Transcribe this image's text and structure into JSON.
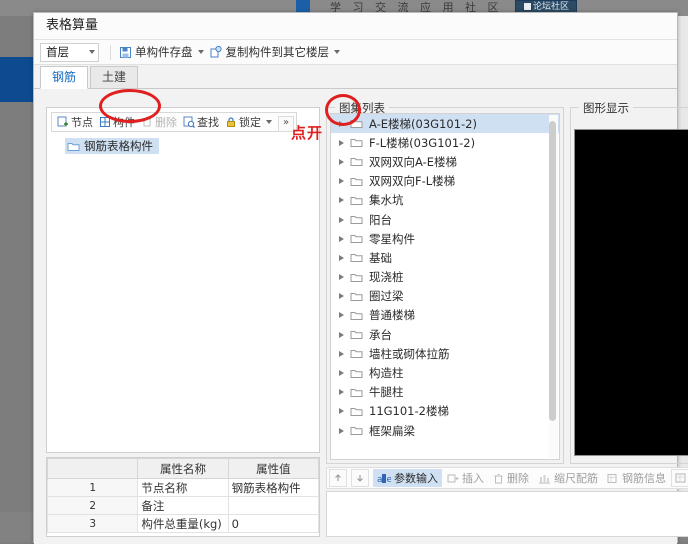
{
  "background": {
    "banner_text": "学 习 交 流 应 用 社 区",
    "logo_text": "论坛社区"
  },
  "window": {
    "title": "表格算量"
  },
  "command_bar": {
    "floor_select": {
      "value": "首层"
    },
    "buttons": [
      {
        "label": "单构件存盘",
        "icon": "save-component-icon",
        "has_caret": true
      },
      {
        "label": "复制构件到其它楼层",
        "icon": "copy-component-icon",
        "has_caret": true
      }
    ]
  },
  "tabs": [
    {
      "label": "钢筋",
      "active": true
    },
    {
      "label": "土建",
      "active": false
    }
  ],
  "left_panel": {
    "toolbar": [
      {
        "label": "节点",
        "icon": "add-node-icon",
        "disabled": false
      },
      {
        "label": "构件",
        "icon": "component-icon",
        "disabled": false
      },
      {
        "label": "删除",
        "icon": "trash-icon",
        "disabled": true
      },
      {
        "label": "查找",
        "icon": "find-icon",
        "disabled": false
      },
      {
        "label": "锁定",
        "icon": "lock-icon",
        "disabled": false,
        "has_caret": true
      }
    ],
    "overflow_label": "»",
    "tree_node": {
      "label": "钢筋表格构件",
      "icon": "folder-icon",
      "selected": true
    },
    "properties": {
      "headers": [
        "属性名称",
        "属性值"
      ],
      "rows": [
        {
          "num": "1",
          "name": "节点名称",
          "value": "钢筋表格构件"
        },
        {
          "num": "2",
          "name": "备注",
          "value": ""
        },
        {
          "num": "3",
          "name": "构件总重量(kg)",
          "value": "0"
        }
      ]
    }
  },
  "middle_panel": {
    "group_label": "图集列表",
    "items": [
      {
        "label": "A-E楼梯(03G101-2)",
        "selected": true
      },
      {
        "label": "F-L楼梯(03G101-2)",
        "selected": false
      },
      {
        "label": "双网双向A-E楼梯",
        "selected": false
      },
      {
        "label": "双网双向F-L楼梯",
        "selected": false
      },
      {
        "label": "集水坑",
        "selected": false
      },
      {
        "label": "阳台",
        "selected": false
      },
      {
        "label": "零星构件",
        "selected": false
      },
      {
        "label": "基础",
        "selected": false
      },
      {
        "label": "现浇桩",
        "selected": false
      },
      {
        "label": "圈过梁",
        "selected": false
      },
      {
        "label": "普通楼梯",
        "selected": false
      },
      {
        "label": "承台",
        "selected": false
      },
      {
        "label": "墙柱或砌体拉筋",
        "selected": false
      },
      {
        "label": "构造柱",
        "selected": false
      },
      {
        "label": "牛腿柱",
        "selected": false
      },
      {
        "label": "11G101-2楼梯",
        "selected": false
      },
      {
        "label": "框架扁梁",
        "selected": false
      }
    ],
    "bottom_toolbar": [
      {
        "label": "",
        "icon": "arrow-up-icon",
        "kind": "square"
      },
      {
        "label": "",
        "icon": "arrow-down-icon",
        "kind": "square"
      },
      {
        "label": "参数输入",
        "icon": "parameter-input-icon",
        "kind": "text",
        "active": true
      },
      {
        "label": "插入",
        "icon": "insert-icon",
        "kind": "text",
        "active": false
      },
      {
        "label": "删除",
        "icon": "trash-icon",
        "kind": "text",
        "active": false
      },
      {
        "label": "缩尺配筋",
        "icon": "scale-rebar-icon",
        "kind": "text",
        "active": false
      },
      {
        "label": "钢筋信息",
        "icon": "rebar-info-icon",
        "kind": "text",
        "active": false
      },
      {
        "label": "",
        "icon": "rebar-table-icon",
        "kind": "square"
      }
    ]
  },
  "right_panel": {
    "group_label": "图形显示"
  },
  "annotations": [
    {
      "kind": "ellipse",
      "target": "component-button"
    },
    {
      "kind": "ellipse",
      "target": "expand-arrow"
    },
    {
      "kind": "text",
      "text": "点开"
    }
  ],
  "colors": {
    "accent_blue": "#1469c0",
    "selection_blue": "#cfe0f2",
    "annotation_red": "#e02020",
    "left_chip_blue": "#0d4a8f"
  }
}
